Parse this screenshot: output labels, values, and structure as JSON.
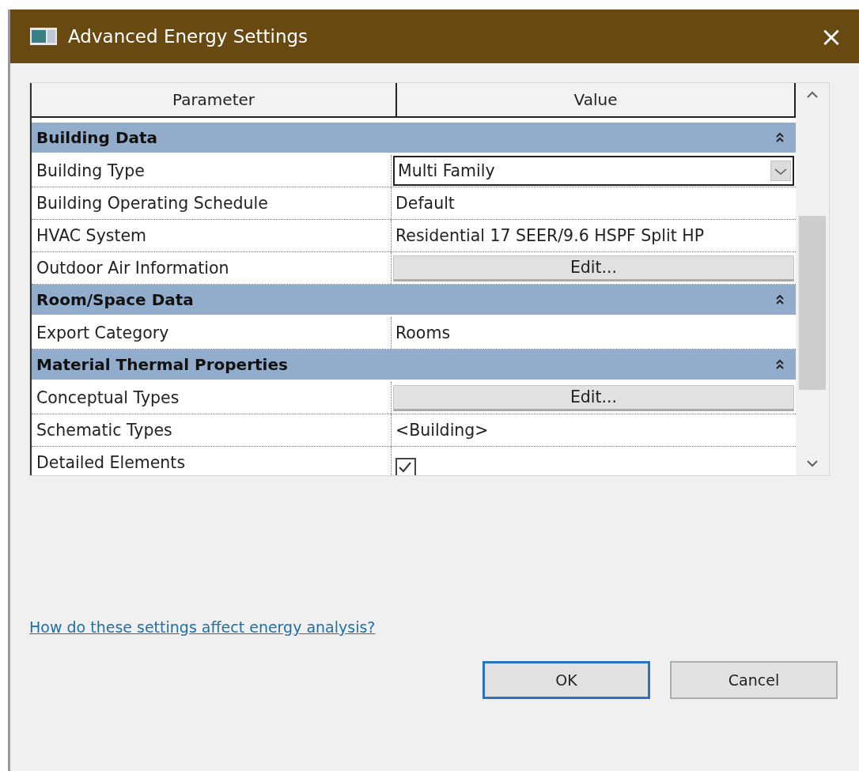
{
  "window": {
    "title": "Advanced Energy Settings",
    "close": "×"
  },
  "table": {
    "columns": [
      "Parameter",
      "Value"
    ],
    "rows": [
      {
        "kind": "section",
        "label": "Building Data",
        "expanded": true
      },
      {
        "kind": "dropdown",
        "label": "Building Type",
        "value": "Multi Family"
      },
      {
        "kind": "text",
        "label": "Building Operating Schedule",
        "value": "Default"
      },
      {
        "kind": "text",
        "label": "HVAC System",
        "value": "Residential 17 SEER/9.6 HSPF Split HP"
      },
      {
        "kind": "button",
        "label": "Outdoor Air Information",
        "value": "Edit..."
      },
      {
        "kind": "section",
        "label": "Room/Space Data",
        "expanded": true
      },
      {
        "kind": "text",
        "label": "Export Category",
        "value": "Rooms"
      },
      {
        "kind": "section",
        "label": "Material Thermal Properties",
        "expanded": true
      },
      {
        "kind": "button",
        "label": "Conceptual Types",
        "value": "Edit..."
      },
      {
        "kind": "text",
        "label": "Schematic Types",
        "value": "<Building>"
      },
      {
        "kind": "checkbox",
        "label": "Detailed Elements",
        "checked": true
      }
    ]
  },
  "help_link": "How do these settings affect energy analysis?",
  "buttons": [
    {
      "label": "OK",
      "default": true
    },
    {
      "label": "Cancel",
      "default": false
    }
  ]
}
